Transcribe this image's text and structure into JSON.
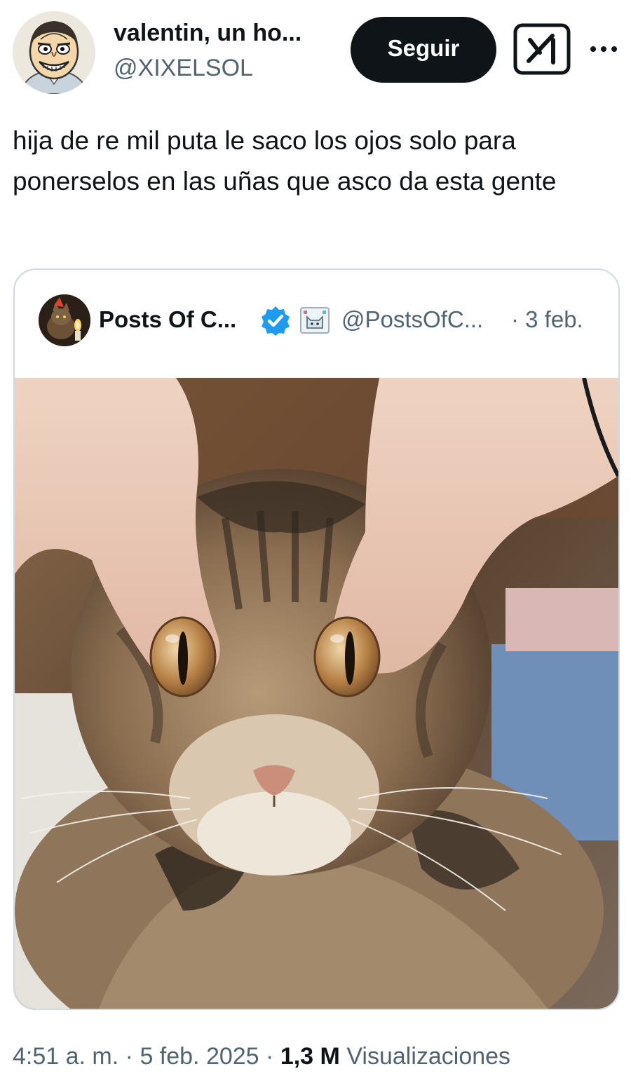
{
  "author": {
    "display_name": "valentin, un ho...",
    "handle": "@XIXELSOL"
  },
  "actions": {
    "follow_label": "Seguir",
    "grok_icon": "grok-icon",
    "more_icon": "more-horizontal-icon"
  },
  "tweet": {
    "text": "hija de re mil puta le saco los ojos solo para ponerselos en las uñas que asco da esta gente"
  },
  "quoted_tweet": {
    "display_name": "Posts Of C...",
    "verified_icon": "verified-badge-icon",
    "emoji_icon": "cat-emoji-icon",
    "handle": "@PostsOfC...",
    "date": "· 3 feb.",
    "image_description_icon": "cat-photo"
  },
  "meta": {
    "time": "4:51 a. m.",
    "date": "5 feb. 2025",
    "views_count": "1,3 M",
    "views_label": "Visualizaciones"
  },
  "colors": {
    "text_primary": "#0f1419",
    "text_secondary": "#536471",
    "border": "#cfd9de",
    "follow_bg": "#0f1419",
    "verified_blue": "#1d9bf0"
  }
}
